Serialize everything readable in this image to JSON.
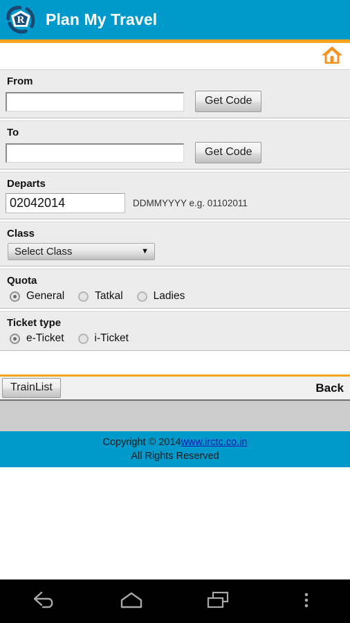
{
  "appbar": {
    "title": "Plan My Travel",
    "logo_icon": "irctc-logo-icon",
    "bg_color": "#0099cc",
    "accent_color": "#faa519"
  },
  "toolbar": {
    "home_icon": "home-icon"
  },
  "form": {
    "from": {
      "label": "From",
      "value": "",
      "placeholder": "",
      "button_label": "Get Code"
    },
    "to": {
      "label": "To",
      "value": "",
      "placeholder": "",
      "button_label": "Get Code"
    },
    "departs": {
      "label": "Departs",
      "value": "02042014",
      "hint": "DDMMYYYY e.g. 01102011"
    },
    "class": {
      "label": "Class",
      "selected": "Select Class",
      "caret_icon": "chevron-down-icon"
    },
    "quota": {
      "label": "Quota",
      "options": [
        {
          "label": "General",
          "selected": true
        },
        {
          "label": "Tatkal",
          "selected": false
        },
        {
          "label": "Ladies",
          "selected": false
        }
      ]
    },
    "ticket_type": {
      "label": "Ticket type",
      "options": [
        {
          "label": "e-Ticket",
          "selected": true
        },
        {
          "label": "i-Ticket",
          "selected": false
        }
      ]
    }
  },
  "actions": {
    "trainlist_label": "TrainList",
    "back_label": "Back"
  },
  "footer": {
    "copyright_prefix": "Copyright © 2014",
    "link_text": "www.irctc.co.in",
    "rights_text": "All Rights Reserved",
    "bg_color": "#0099cc",
    "link_color": "#1a16b0"
  },
  "navbar": {
    "back_icon": "back-arrow-icon",
    "home_icon": "home-pentagon-icon",
    "recents_icon": "recent-apps-icon",
    "overflow_icon": "overflow-menu-icon"
  }
}
